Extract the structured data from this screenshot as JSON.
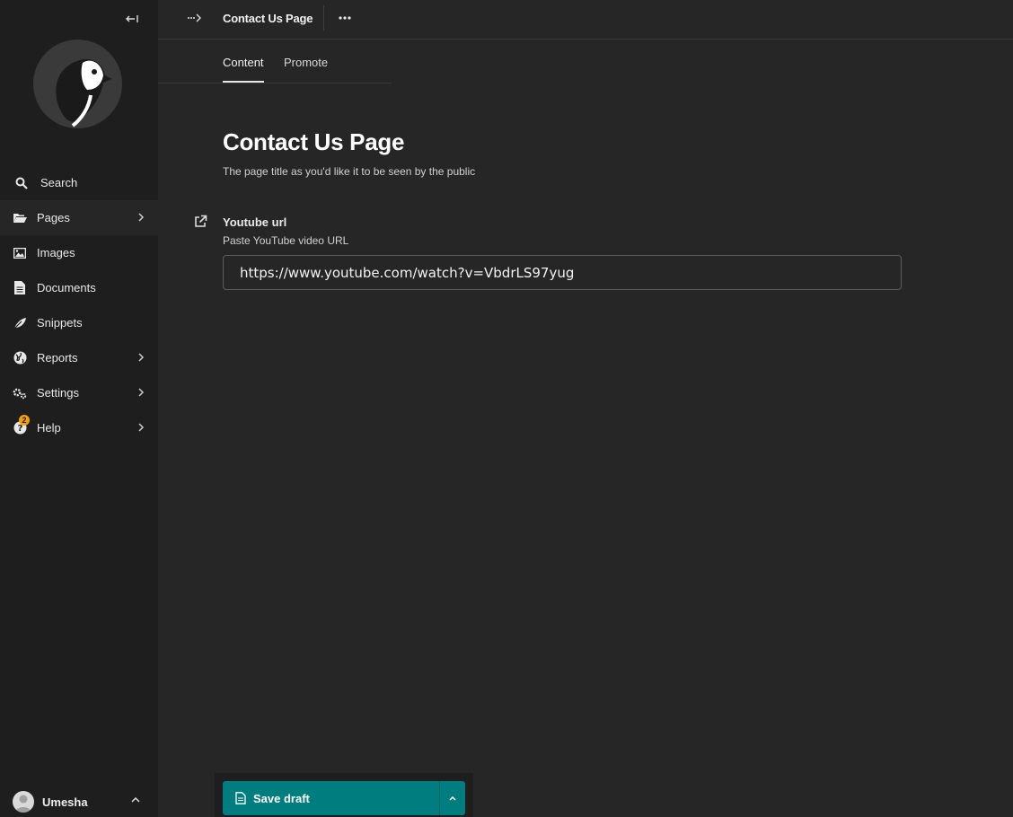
{
  "sidebar": {
    "collapse_icon": "collapse-left-icon",
    "logo": "wagtail-bird-logo",
    "items": [
      {
        "label": "Search",
        "icon": "search-icon"
      },
      {
        "label": "Pages",
        "icon": "folder-open-icon",
        "has_submenu": true
      },
      {
        "label": "Images",
        "icon": "image-icon"
      },
      {
        "label": "Documents",
        "icon": "document-icon"
      },
      {
        "label": "Snippets",
        "icon": "snippet-icon"
      },
      {
        "label": "Reports",
        "icon": "globe-icon",
        "has_submenu": true
      },
      {
        "label": "Settings",
        "icon": "cogs-icon",
        "has_submenu": true
      },
      {
        "label": "Help",
        "icon": "help-icon",
        "has_submenu": true,
        "badge": "2"
      }
    ],
    "account": {
      "name": "Umesha",
      "icon": "avatar"
    }
  },
  "header": {
    "breadcrumb_title": "Contact Us Page",
    "more_icon": "more-horizontal-icon"
  },
  "tabs": [
    {
      "label": "Content",
      "active": true
    },
    {
      "label": "Promote",
      "active": false
    }
  ],
  "main": {
    "title": "Contact Us Page",
    "subtitle": "The page title as you'd like it to be seen by the public",
    "field": {
      "label": "Youtube url",
      "help": "Paste YouTube video URL",
      "value": "https://www.youtube.com/watch?v=VbdrLS97yug"
    }
  },
  "footer": {
    "save_label": "Save draft"
  },
  "colors": {
    "sidebar_bg": "#1e1e1e",
    "main_bg": "#262626",
    "primary_button": "#007d7e",
    "badge": "#f59e0b"
  }
}
